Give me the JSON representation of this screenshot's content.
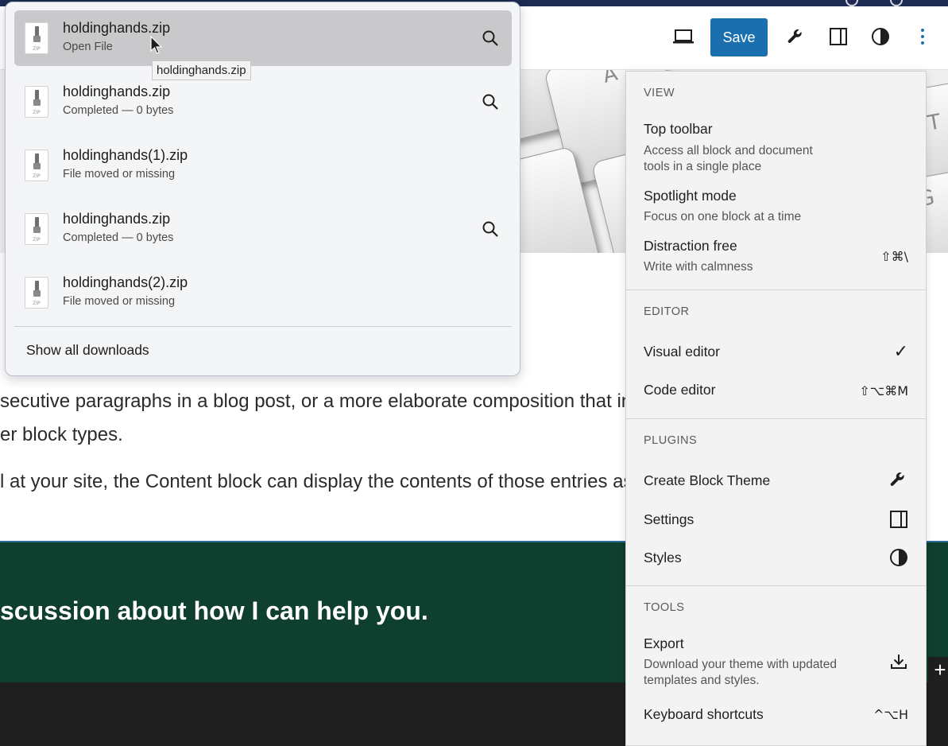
{
  "downloads": {
    "items": [
      {
        "name": "holdinghands.zip",
        "status": "Open File",
        "icon": "zip-file-icon",
        "has_search": true
      },
      {
        "name": "holdinghands.zip",
        "status": "Completed — 0 bytes",
        "icon": "zip-file-icon",
        "has_search": true
      },
      {
        "name": "holdinghands(1).zip",
        "status": "File moved or missing",
        "icon": "zip-file-icon",
        "has_search": false
      },
      {
        "name": "holdinghands.zip",
        "status": "Completed — 0 bytes",
        "icon": "zip-file-icon",
        "has_search": true
      },
      {
        "name": "holdinghands(2).zip",
        "status": "File moved or missing",
        "icon": "zip-file-icon",
        "has_search": false
      }
    ],
    "file_icon_ext": "ZIP",
    "show_all": "Show all downloads",
    "tooltip": "holdinghands.zip"
  },
  "toolbar": {
    "save_label": "Save",
    "save_color": "#1a6fae",
    "icons": [
      "desktop-preview-icon",
      "wrench-icon",
      "sidebar-icon",
      "styles-contrast-icon",
      "more-options-icon"
    ]
  },
  "content": {
    "para1_line1": "secutive paragraphs in a blog post, or a more elaborate composition that inc",
    "para1_line2": "er block types.",
    "para2": "l at your site, the Content block can display the contents of those entries as",
    "cta_text": "scussion about how I can help you.",
    "cta_bg": "#0f3f2e"
  },
  "menu": {
    "view": {
      "label": "VIEW",
      "items": [
        {
          "title": "Top toolbar",
          "desc_line1": "Access all block and document",
          "desc_line2": "tools in a single place"
        },
        {
          "title": "Spotlight mode",
          "desc_line1": "Focus on one block at a time"
        },
        {
          "title": "Distraction free",
          "desc_line1": "Write with calmness",
          "shortcut": "⇧⌘\\"
        }
      ]
    },
    "editor": {
      "label": "EDITOR",
      "items": [
        {
          "title": "Visual editor",
          "check": "✓",
          "selected": true
        },
        {
          "title": "Code editor",
          "shortcut": "⇧⌥⌘M"
        }
      ]
    },
    "plugins": {
      "label": "PLUGINS",
      "items": [
        {
          "title": "Create Block Theme",
          "icon": "wrench-icon"
        },
        {
          "title": "Settings",
          "icon": "sidebar-panel-icon"
        },
        {
          "title": "Styles",
          "icon": "contrast-icon"
        }
      ]
    },
    "tools": {
      "label": "TOOLS",
      "items": [
        {
          "title": "Export",
          "desc_line1": "Download your theme with updated",
          "desc_line2": "templates and styles.",
          "icon": "download-icon"
        },
        {
          "title": "Keyboard shortcuts",
          "shortcut": "^⌥H"
        }
      ]
    }
  }
}
